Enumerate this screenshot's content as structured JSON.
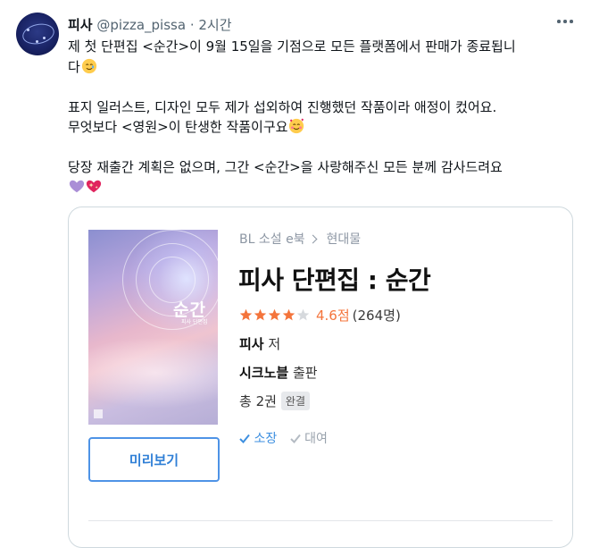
{
  "tweet": {
    "author_name": "피사",
    "handle": "@pizza_pissa",
    "separator": "·",
    "time": "2시간",
    "lines": [
      "제 첫 단편집 <순간>이 9월 15일을 기점으로 모든 플랫폼에서 판매가 종료됩니",
      "다",
      "표지 일러스트, 디자인 모두 제가 섭외하여 진행했던 작품이라 애정이 컸어요.",
      "무엇보다 <영원>이 탄생한 작품이구요",
      "당장 재출간 계획은 없으며, 그간 <순간>을 사랑해주신 모든 분께 감사드려요"
    ],
    "emoji": [
      "smiling-tear-face-emoji",
      "smiling-face-with-hearts-emoji",
      "purple-heart-emoji",
      "sparkling-heart-emoji"
    ]
  },
  "card": {
    "breadcrumb_category": "BL 소설 e북",
    "breadcrumb_sub": "현대물",
    "book_title": "피사 단편집 : 순간",
    "rating_stars": 4.6,
    "rating_value": "4.6점",
    "rating_count": "(264명)",
    "author_name": "피사",
    "author_suffix": "저",
    "publisher_name": "시크노블",
    "publisher_suffix": "출판",
    "volumes": "총 2권",
    "status_badge": "완결",
    "owned_label": "소장",
    "rent_label": "대여",
    "preview_button": "미리보기",
    "cover_title": "순간",
    "cover_subtitle": "피사 단편집"
  },
  "colors": {
    "star": "#f4743b",
    "accent_blue": "#2f7fd6"
  }
}
